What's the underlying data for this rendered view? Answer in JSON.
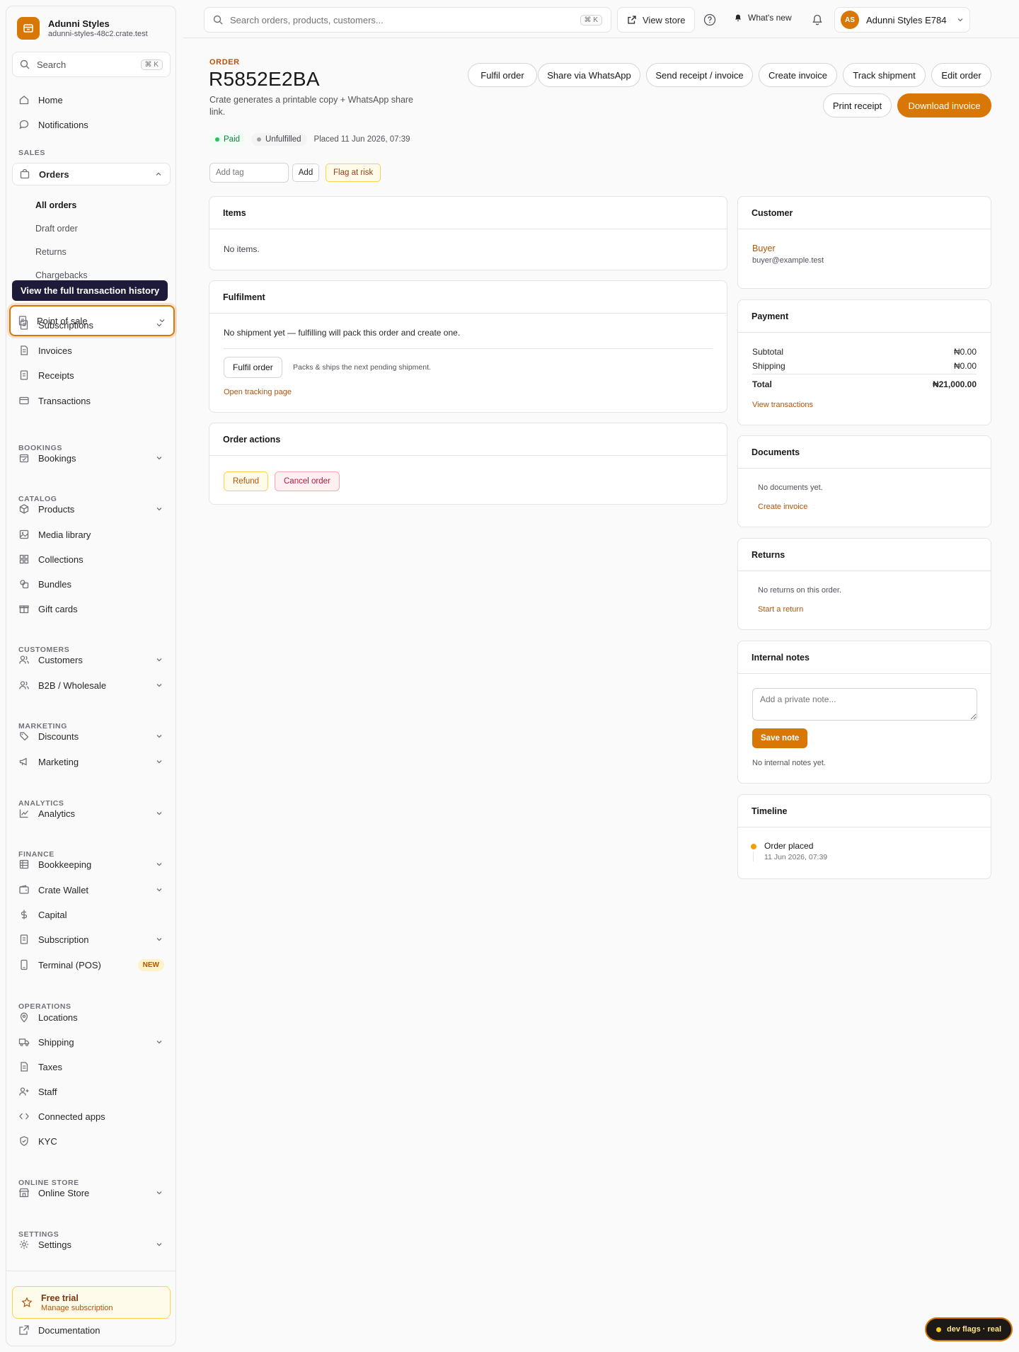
{
  "brand": {
    "name": "Adunni Styles",
    "domain": "adunni-styles-48c2.crate.test"
  },
  "sidebar": {
    "search_label": "Search",
    "search_kbd": "⌘ K",
    "home": "Home",
    "notifications": "Notifications",
    "sections": {
      "sales": "SALES",
      "bookings": "BOOKINGS",
      "catalog": "CATALOG",
      "customers": "CUSTOMERS",
      "marketing": "MARKETING",
      "analytics": "ANALYTICS",
      "finance": "FINANCE",
      "operations": "OPERATIONS",
      "online_store": "ONLINE STORE",
      "settings": "SETTINGS"
    },
    "orders": "Orders",
    "orders_sub": [
      "All orders",
      "Draft order",
      "Returns",
      "Chargebacks"
    ],
    "tooltip": "View the full transaction history",
    "point_of_sale": "Point of sale",
    "subscriptions": "Subscriptions",
    "invoices": "Invoices",
    "receipts": "Receipts",
    "transactions": "Transactions",
    "bookings": "Bookings",
    "products": "Products",
    "media_library": "Media library",
    "collections": "Collections",
    "bundles": "Bundles",
    "gift_cards": "Gift cards",
    "customers": "Customers",
    "b2b": "B2B / Wholesale",
    "discounts": "Discounts",
    "marketing": "Marketing",
    "analytics": "Analytics",
    "bookkeeping": "Bookkeeping",
    "crate_wallet": "Crate Wallet",
    "capital": "Capital",
    "subscription": "Subscription",
    "terminal": "Terminal (POS)",
    "terminal_badge": "NEW",
    "locations": "Locations",
    "shipping": "Shipping",
    "taxes": "Taxes",
    "staff": "Staff",
    "connected_apps": "Connected apps",
    "kyc": "KYC",
    "online_store": "Online Store",
    "settings": "Settings",
    "trial_title": "Free trial",
    "trial_link": "Manage subscription",
    "documentation": "Documentation"
  },
  "topbar": {
    "search_placeholder": "Search orders, products, customers...",
    "search_kbd": "⌘ K",
    "view_store": "View store",
    "whats_new": "What's new",
    "account_initials": "AS",
    "account_name": "Adunni Styles E784"
  },
  "order": {
    "eyebrow": "ORDER",
    "id": "R5852E2BA",
    "description": "Crate generates a printable copy + WhatsApp share link.",
    "actions": [
      "Fulfil order",
      "Share via WhatsApp",
      "Send receipt / invoice",
      "Create invoice",
      "Track shipment",
      "Edit order"
    ],
    "print_receipt": "Print receipt",
    "download_invoice": "Download invoice",
    "status_paid": "Paid",
    "status_fulfillment": "Unfulfilled",
    "placed": "Placed 11 Jun 2026, 07:39",
    "tag_placeholder": "Add tag",
    "tag_add": "Add",
    "flag_at_risk": "Flag at risk"
  },
  "items": {
    "title": "Items",
    "empty": "No items."
  },
  "fulfilment": {
    "title": "Fulfilment",
    "empty": "No shipment yet — fulfilling will pack this order and create one.",
    "button": "Fulfil order",
    "hint": "Packs & ships the next pending shipment.",
    "tracking_link": "Open tracking page"
  },
  "order_actions": {
    "title": "Order actions",
    "refund": "Refund",
    "cancel": "Cancel order"
  },
  "customer": {
    "title": "Customer",
    "name": "Buyer",
    "email": "buyer@example.test"
  },
  "payment": {
    "title": "Payment",
    "subtotal_label": "Subtotal",
    "subtotal": "₦0.00",
    "shipping_label": "Shipping",
    "shipping": "₦0.00",
    "total_label": "Total",
    "total": "₦21,000.00",
    "view_transactions": "View transactions"
  },
  "documents": {
    "title": "Documents",
    "empty": "No documents yet.",
    "create": "Create invoice"
  },
  "returns": {
    "title": "Returns",
    "empty": "No returns on this order.",
    "start": "Start a return"
  },
  "notes": {
    "title": "Internal notes",
    "placeholder": "Add a private note...",
    "save": "Save note",
    "empty": "No internal notes yet."
  },
  "timeline": {
    "title": "Timeline",
    "event": "Order placed",
    "time": "11 Jun 2026, 07:39"
  },
  "dev_flags": "dev flags · real",
  "colors": {
    "accent": "#d97706",
    "paid": "#15803d",
    "danger": "#be123c"
  }
}
